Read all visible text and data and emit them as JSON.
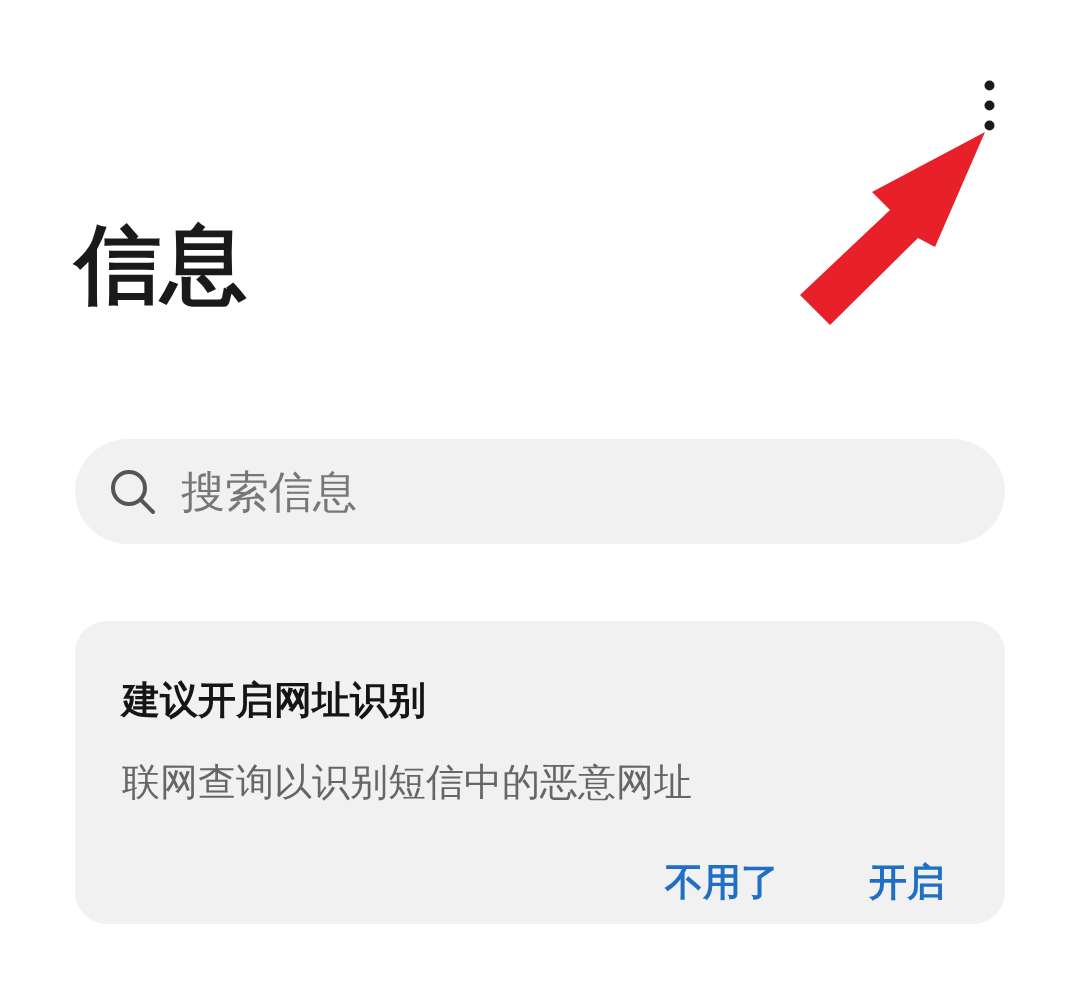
{
  "title": "信息",
  "search": {
    "placeholder": "搜索信息"
  },
  "suggestion_card": {
    "title": "建议开启网址识别",
    "description": "联网查询以识别短信中的恶意网址",
    "actions": [
      {
        "label": "不用了"
      },
      {
        "label": "开启"
      }
    ]
  }
}
